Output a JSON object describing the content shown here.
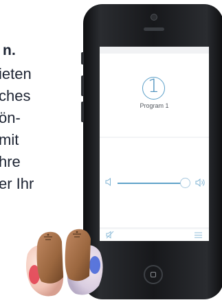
{
  "marketing": {
    "heading": "n.",
    "lines": [
      "ieten",
      "ches",
      "ön-",
      "mit",
      "hre",
      "er Ihr"
    ]
  },
  "app": {
    "program": {
      "number": "1",
      "label": "Program 1"
    },
    "volume": {
      "level": 0.95
    }
  },
  "icons": {
    "volume_low": "speaker-low-icon",
    "volume_high": "speaker-high-icon",
    "mute": "mute-icon",
    "menu": "menu-icon",
    "home": "home-button"
  },
  "colors": {
    "accent": "#4a8fbc",
    "skin_aid": "#a26f4b",
    "left_marker": "#e23b4c",
    "right_marker": "#3f63d8"
  }
}
